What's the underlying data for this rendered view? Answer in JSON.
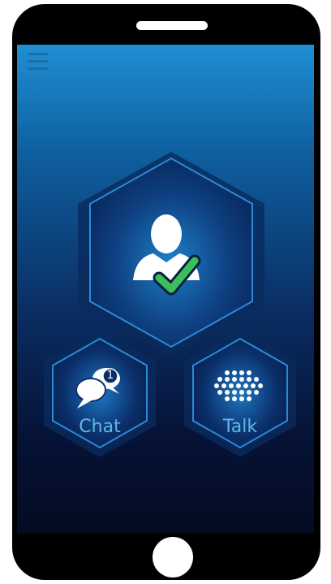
{
  "buttons": {
    "chat_label": "Chat",
    "chat_badge": "1",
    "talk_label": "Talk"
  },
  "icons": {
    "menu": "hamburger-menu-icon",
    "profile": "verified-user-icon",
    "chat": "chat-bubbles-icon",
    "talk": "dot-grid-speaker-icon"
  },
  "colors": {
    "screen_top": "#1f8fd3",
    "screen_bottom": "#040b22",
    "accent": "#5fb7e6",
    "check": "#3bbf5a"
  }
}
